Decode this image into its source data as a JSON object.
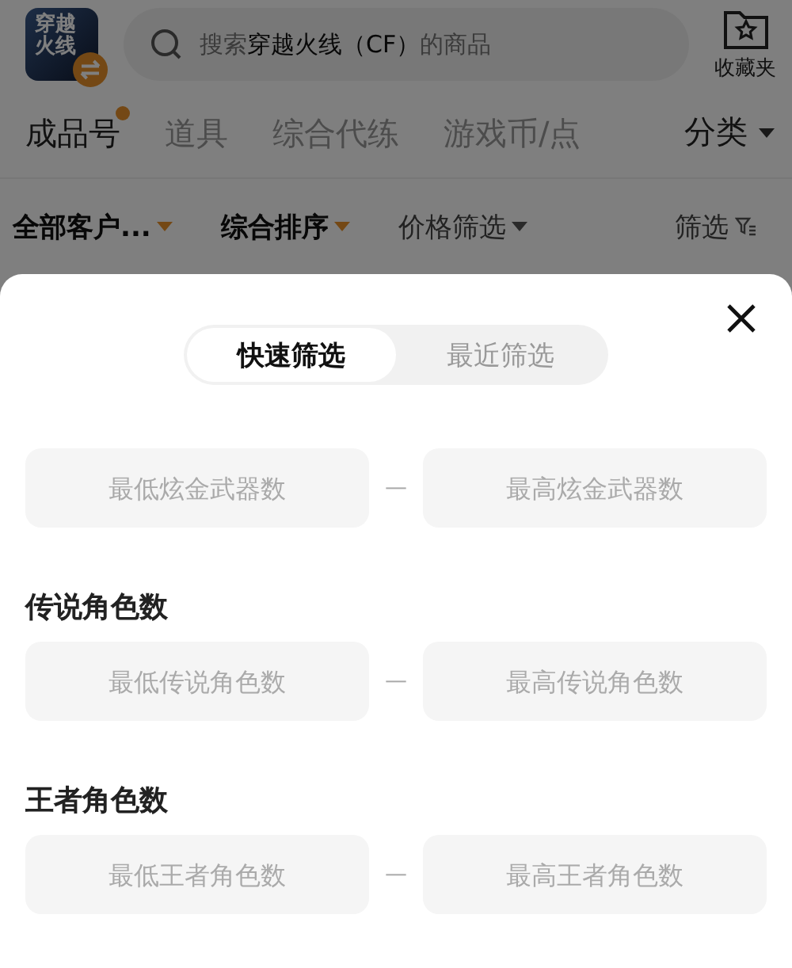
{
  "header": {
    "app_icon_text": "穿越火线",
    "search": {
      "placeholder": "搜索**穿越火线（CF）**的商品"
    },
    "favorites": {
      "label": "收藏夹"
    }
  },
  "category_tabs": [
    {
      "label": "成品号",
      "selected": true,
      "dot": true
    },
    {
      "label": "道具",
      "selected": false,
      "dot": false
    },
    {
      "label": "综合代练",
      "selected": false,
      "dot": false
    },
    {
      "label": "游戏币/点",
      "selected": false,
      "dot": false
    }
  ],
  "category_menu": {
    "label": "分类"
  },
  "filters": [
    {
      "label": "全部客户...",
      "kind": "dropdown",
      "active": true
    },
    {
      "label": "综合排序",
      "kind": "dropdown",
      "active": true
    },
    {
      "label": "价格筛选",
      "kind": "dropdown",
      "active": false
    },
    {
      "label": "筛选",
      "kind": "funnel",
      "active": false
    }
  ],
  "sheet": {
    "modes": [
      {
        "label": "快速筛选",
        "selected": true
      },
      {
        "label": "最近筛选",
        "selected": false
      }
    ],
    "sections": [
      {
        "min_placeholder": "最低炫金武器数",
        "max_placeholder": "最高炫金武器数",
        "separator": "—"
      },
      {
        "title": "传说角色数",
        "min_placeholder": "最低传说角色数",
        "max_placeholder": "最高传说角色数",
        "separator": "—"
      },
      {
        "title": "王者角色数",
        "min_placeholder": "最低王者角色数",
        "max_placeholder": "最高王者角色数",
        "separator": "—"
      }
    ]
  }
}
